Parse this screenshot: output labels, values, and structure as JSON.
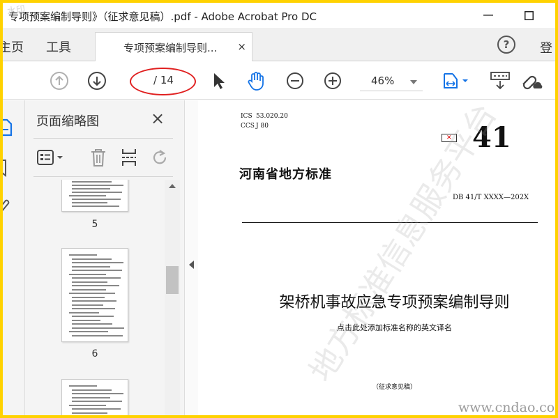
{
  "window": {
    "title": "专项预案编制导则》（征求意见稿）.pdf - Adobe Acrobat Pro DC",
    "minimize_label": "—",
    "maximize_label": "☐"
  },
  "tabs": {
    "home": "主页",
    "tools": "工具",
    "document": "专项预案编制导则...",
    "close": "×",
    "help": "?",
    "login": "登"
  },
  "toolbar": {
    "page_total": "/ 14",
    "zoom": "46%"
  },
  "panel": {
    "title": "页面缩略图",
    "close": "×",
    "thumbnails": [
      {
        "label": "5"
      },
      {
        "label": "6"
      }
    ]
  },
  "document": {
    "ics": "ICS",
    "ics_code": "53.020.20",
    "ccs": "CCS",
    "ccs_code": "J 80",
    "code_41": "41",
    "province_std": "河南省地方标准",
    "db_no": "DB 41/T XXXX—202X",
    "main_title": "架桥机事故应急专项预案编制导则",
    "en_title": "点击此处添加标准名称的英文译名",
    "draft": "（征求意见稿）"
  },
  "watermark": {
    "diagonal": "地方标准信息服务平台",
    "site": "www.cndao.com",
    "corner": "水印"
  },
  "colors": {
    "frame": "#ffd200",
    "accent_blue": "#1473e6",
    "ellipse_red": "#e02020"
  }
}
